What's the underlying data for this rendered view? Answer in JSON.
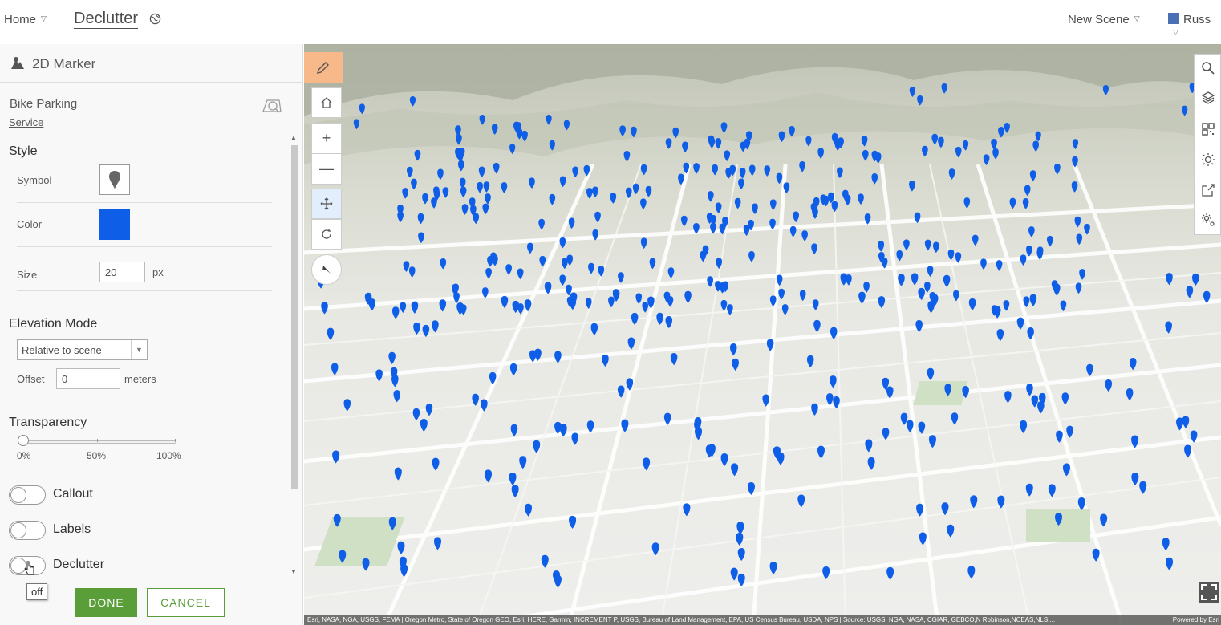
{
  "header": {
    "home_label": "Home",
    "title": "Declutter",
    "new_scene_label": "New Scene",
    "user_name": "Russ"
  },
  "panel": {
    "title": "2D Marker",
    "layer_name": "Bike Parking",
    "layer_link": "Service",
    "style_heading": "Style",
    "symbol_label": "Symbol",
    "color_label": "Color",
    "color_value": "#0e5ee8",
    "size_label": "Size",
    "size_value": "20",
    "size_unit": "px",
    "elevation_heading": "Elevation Mode",
    "elevation_mode": "Relative to scene",
    "offset_label": "Offset",
    "offset_value": "0",
    "offset_unit": "meters",
    "transparency_heading": "Transparency",
    "transparency_value": 0,
    "transparency_ticks": [
      "0%",
      "50%",
      "100%"
    ],
    "toggles": [
      {
        "label": "Callout",
        "on": false
      },
      {
        "label": "Labels",
        "on": false
      },
      {
        "label": "Declutter",
        "on": false
      }
    ],
    "tooltip": "off",
    "done_label": "DONE",
    "cancel_label": "CANCEL"
  },
  "map": {
    "pin_color": "#0e5ee8",
    "accent_tool_color": "#f7b98a",
    "attribution": "Esri, NASA, NGA, USGS, FEMA | Oregon Metro, State of Oregon GEO, Esri, HERE, Garmin, INCREMENT P, USGS, Bureau of Land Management, EPA, US Census Bureau, USDA, NPS | Source: USGS, NGA, NASA, CGIAR, GEBCO,N Robinson,NCEAS,NLS,...",
    "powered_by": "Powered by Esri"
  }
}
